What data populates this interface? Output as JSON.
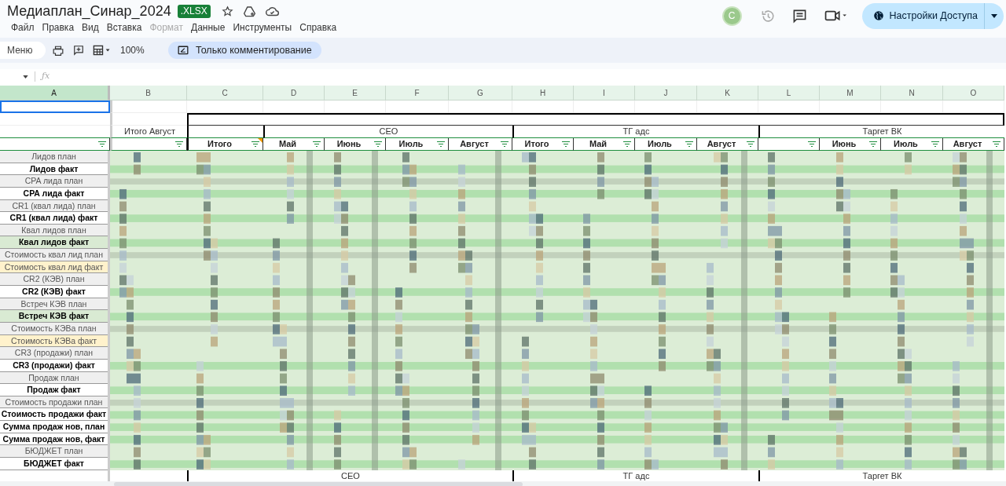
{
  "title": "Медиаплан_Синар_2024",
  "file_badge": ".XLSX",
  "menu": [
    {
      "label": "Файл",
      "disabled": false
    },
    {
      "label": "Правка",
      "disabled": false
    },
    {
      "label": "Вид",
      "disabled": false
    },
    {
      "label": "Вставка",
      "disabled": false
    },
    {
      "label": "Формат",
      "disabled": true
    },
    {
      "label": "Данные",
      "disabled": false
    },
    {
      "label": "Инструменты",
      "disabled": false
    },
    {
      "label": "Справка",
      "disabled": false
    }
  ],
  "account_initial": "С",
  "share_button": "Настройки Доступа",
  "toolbar": {
    "search": "Меню",
    "zoom": "100%",
    "mode": "Только комментирование"
  },
  "columns": [
    {
      "label": "A",
      "selected": true
    },
    {
      "label": "B",
      "selected": false
    },
    {
      "label": "C",
      "selected": false
    },
    {
      "label": "D",
      "selected": false
    },
    {
      "label": "E",
      "selected": false
    },
    {
      "label": "F",
      "selected": false
    },
    {
      "label": "G",
      "selected": false
    },
    {
      "label": "H",
      "selected": false
    },
    {
      "label": "I",
      "selected": false
    },
    {
      "label": "J",
      "selected": false
    },
    {
      "label": "K",
      "selected": false
    },
    {
      "label": "L",
      "selected": false
    },
    {
      "label": "M",
      "selected": false
    },
    {
      "label": "N",
      "selected": false
    },
    {
      "label": "O",
      "selected": false
    }
  ],
  "summary_header": "Итого Август",
  "formula_label": "ƒx",
  "groups": [
    {
      "label": "СЕО"
    },
    {
      "label": "ТГ адс"
    },
    {
      "label": "Таргет ВК"
    }
  ],
  "subheaders": [
    {
      "note": false
    },
    {
      "label": "Итого",
      "note": true
    },
    {
      "label": "Май",
      "note": false
    },
    {
      "label": "Июнь",
      "note": false
    },
    {
      "label": "Июль",
      "note": false
    },
    {
      "label": "Август",
      "note": false
    },
    {
      "label": "Итого",
      "note": false
    },
    {
      "label": "Май",
      "note": false
    },
    {
      "label": "Июль",
      "note": false
    },
    {
      "label": "Август",
      "note": false
    },
    {
      "note": false
    },
    {
      "label": "Июнь",
      "note": false
    },
    {
      "label": "Июль",
      "note": false
    },
    {
      "label": "Август",
      "note": false
    }
  ],
  "rows": [
    {
      "label": "Лидов план",
      "bold": false,
      "color": "#efefef"
    },
    {
      "label": "Лидов факт",
      "bold": true,
      "color": "#ffffff"
    },
    {
      "label": "CPA лида план",
      "bold": false,
      "color": "#efefef"
    },
    {
      "label": "CPA лида факт",
      "bold": true,
      "color": "#ffffff"
    },
    {
      "label": "CR1 (квал лида) план",
      "bold": false,
      "color": "#efefef"
    },
    {
      "label": "CR1 (квал лида) факт",
      "bold": true,
      "color": "#ffffff"
    },
    {
      "label": "Квал лидов план",
      "bold": false,
      "color": "#efefef"
    },
    {
      "label": "Квал лидов факт",
      "bold": true,
      "color": "#d9ead3"
    },
    {
      "label": "Стоимость квал лид план",
      "bold": false,
      "color": "#efefef"
    },
    {
      "label": "Стоимость квал лид факт",
      "bold": false,
      "color": "#fff2cc"
    },
    {
      "label": "CR2 (КЭВ) план",
      "bold": false,
      "color": "#efefef"
    },
    {
      "label": "CR2 (КЭВ) факт",
      "bold": true,
      "color": "#ffffff"
    },
    {
      "label": "Встреч КЭВ план",
      "bold": false,
      "color": "#efefef"
    },
    {
      "label": "Встреч КЭВ факт",
      "bold": true,
      "color": "#d9ead3"
    },
    {
      "label": "Стоимость КЭВа план",
      "bold": false,
      "color": "#efefef"
    },
    {
      "label": "Стоимость КЭВа факт",
      "bold": false,
      "color": "#fff2cc"
    },
    {
      "label": "CR3 (продажи) план",
      "bold": false,
      "color": "#efefef"
    },
    {
      "label": "CR3 (продажи) факт",
      "bold": true,
      "color": "#ffffff"
    },
    {
      "label": "Продаж план",
      "bold": false,
      "color": "#efefef"
    },
    {
      "label": "Продаж факт",
      "bold": true,
      "color": "#ffffff"
    },
    {
      "label": "Стоимость продажи план",
      "bold": false,
      "color": "#efefef"
    },
    {
      "label": "Стоимость продажи факт",
      "bold": true,
      "color": "#ffffff"
    },
    {
      "label": "Сумма продаж нов, план",
      "bold": true,
      "color": "#ffffff"
    },
    {
      "label": "Сумма продаж нов, факт",
      "bold": true,
      "color": "#ffffff"
    },
    {
      "label": "БЮДЖЕТ план",
      "bold": false,
      "color": "#efefef"
    },
    {
      "label": "БЮДЖЕТ факт",
      "bold": true,
      "color": "#ffffff"
    }
  ],
  "footer_groups": [
    {
      "label": "СЕО"
    },
    {
      "label": "ТГ адс"
    },
    {
      "label": "Таргет ВК"
    }
  ]
}
